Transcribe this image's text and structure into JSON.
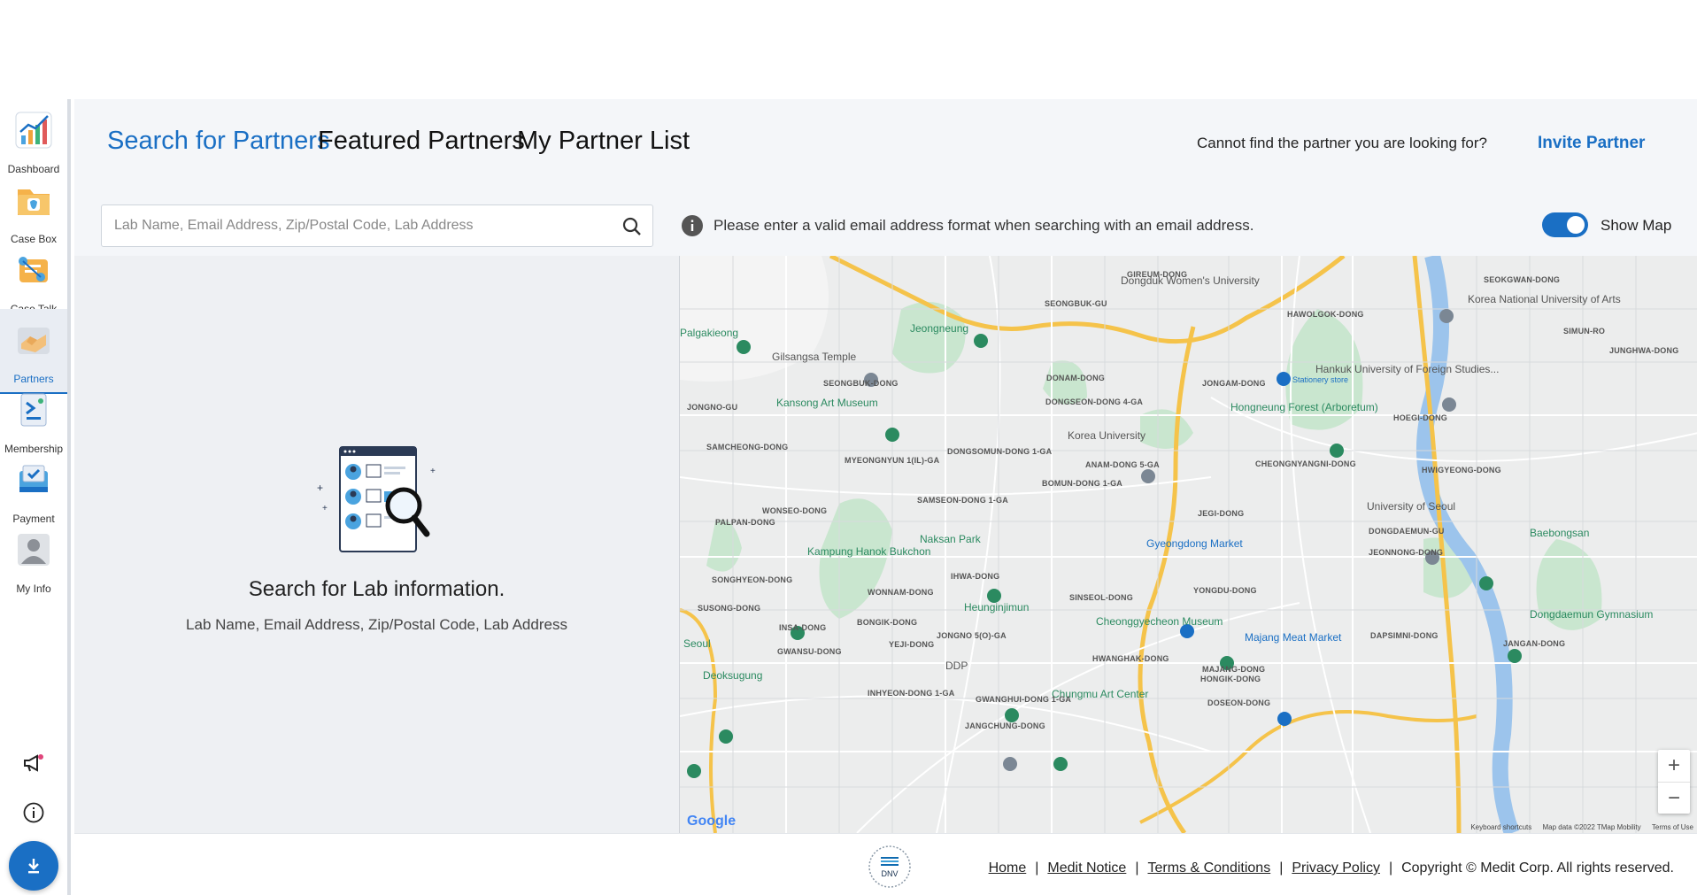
{
  "sidebar": {
    "items": [
      {
        "label": "Dashboard",
        "icon": "dashboard-chart-icon"
      },
      {
        "label": "Case Box",
        "icon": "case-box-folder-icon"
      },
      {
        "label": "Case Talk",
        "icon": "case-talk-icon"
      },
      {
        "label": "Partners",
        "icon": "partners-handshake-icon",
        "active": true
      },
      {
        "label": "Membership",
        "icon": "membership-icon"
      },
      {
        "label": "Payment",
        "icon": "payment-icon"
      },
      {
        "label": "My Info",
        "icon": "my-info-person-icon"
      }
    ],
    "utility": [
      "megaphone-icon",
      "info-icon",
      "download-icon"
    ]
  },
  "tabs": [
    {
      "label": "Search for Partners",
      "active": true
    },
    {
      "label": "Featured Partners",
      "active": false
    },
    {
      "label": "My Partner List",
      "active": false
    }
  ],
  "header": {
    "cannot_find": "Cannot find the partner you are looking for?",
    "invite_partner": "Invite Partner"
  },
  "search": {
    "placeholder": "Lab Name, Email Address, Zip/Postal Code, Lab Address",
    "value": ""
  },
  "info_message": "Please enter a valid email address format when searching with an email address.",
  "show_map": {
    "label": "Show Map",
    "enabled": true
  },
  "empty_state": {
    "title": "Search for Lab information.",
    "subtitle": "Lab Name, Email Address, Zip/Postal Code, Lab Address"
  },
  "map": {
    "places": [
      {
        "text": "Jeongneung",
        "kind": "green"
      },
      {
        "text": "Gilsangsa Temple",
        "kind": "gray"
      },
      {
        "text": "Kansong Art Museum",
        "kind": "green"
      },
      {
        "text": "Korea University",
        "kind": "gray"
      },
      {
        "text": "Hongneung Forest (Arboretum)",
        "kind": "green"
      },
      {
        "text": "Hankuk University of Foreign Studies...",
        "kind": "gray"
      },
      {
        "text": "Korea National University of Arts",
        "kind": "gray"
      },
      {
        "text": "Dongduk Women's University",
        "kind": "gray"
      },
      {
        "text": "University of Seoul",
        "kind": "gray"
      },
      {
        "text": "Baebongsan",
        "kind": "green"
      },
      {
        "text": "Naksan Park",
        "kind": "green"
      },
      {
        "text": "Gyeongdong Market",
        "kind": "blue"
      },
      {
        "text": "Kampung Hanok Bukchon",
        "kind": "green"
      },
      {
        "text": "Heunginjimun",
        "kind": "green"
      },
      {
        "text": "Cheonggyecheon Museum",
        "kind": "green"
      },
      {
        "text": "Majang Meat Market",
        "kind": "blue"
      },
      {
        "text": "Dongdaemun Gymnasium",
        "kind": "green"
      },
      {
        "text": "DDP",
        "kind": "gray"
      },
      {
        "text": "Chungmu Art Center",
        "kind": "green"
      },
      {
        "text": "Deoksugung",
        "kind": "green"
      },
      {
        "text": "Seoul",
        "kind": "green"
      },
      {
        "text": "Palgakieong",
        "kind": "green"
      },
      {
        "text": "Stationery store",
        "kind": "blue"
      }
    ],
    "districts": [
      "GIREUM-DONG",
      "SEONGBUK-GU",
      "HAWOLGOK-DONG",
      "SEOKGWAN-DONG",
      "JONGNO-GU",
      "SEONGBUK-DONG",
      "DONAM-DONG",
      "JONGAM-DONG",
      "DONGSEON-DONG 4-GA",
      "SAMCHEONG-DONG",
      "MYEONGNYUN 1(IL)-GA",
      "DONGSOMUN-DONG 1-GA",
      "ANAM-DONG 5-GA",
      "CHEONGNYANGNI-DONG",
      "HOEGI-DONG",
      "BOMUN-DONG 1-GA",
      "HWIGYEONG-DONG",
      "WONSEO-DONG",
      "SAMSEON-DONG 1-GA",
      "JEGI-DONG",
      "DONGDAEMUN-GU",
      "JEONNONG-DONG",
      "SINSEOL-DONG",
      "YONGDU-DONG",
      "WONNAM-DONG",
      "IHWA-DONG",
      "JONGNO 5(O)-GA",
      "HWANGHAK-DONG",
      "MAJANG-DONG",
      "DAPSIMNI-DONG",
      "JANGAN-DONG",
      "INSA-DONG",
      "GWANSU-DONG",
      "YEJI-DONG",
      "HONGIK-DONG",
      "DOSEON-DONG",
      "INHYEON-DONG 1-GA",
      "GWANGHUI-DONG 1-GA",
      "JANGCHUNG-DONG",
      "SONGHYEON-DONG",
      "SUSONG-DONG",
      "BONGIK-DONG",
      "PALPAN-DONG",
      "JUNGHWA-DONG",
      "SIMUN-RO"
    ],
    "attribution": {
      "shortcuts": "Keyboard shortcuts",
      "data": "Map data ©2022 TMap Mobility",
      "terms": "Terms of Use"
    },
    "google": "Google",
    "zoom_in": "+",
    "zoom_out": "−"
  },
  "footer": {
    "links": [
      "Home",
      "Medit Notice",
      "Terms & Conditions",
      "Privacy Policy"
    ],
    "copyright": "Copyright © Medit Corp. All rights reserved.",
    "logo_text": "DNV"
  },
  "colors": {
    "accent": "#1a6fc4",
    "map_green": "#2b8a60",
    "road_yellow": "#f5c34a"
  }
}
